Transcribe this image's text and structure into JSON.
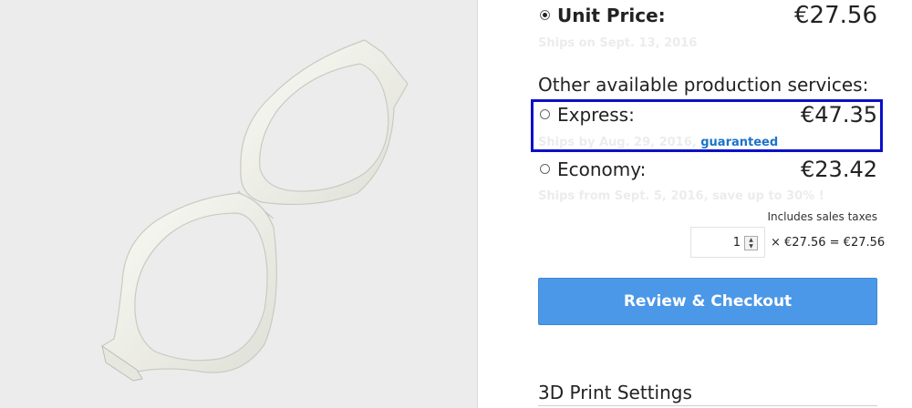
{
  "unit_price": {
    "label": "Unit Price:",
    "price": "€27.56",
    "ships": "Ships on Sept. 13, 2016",
    "selected": true
  },
  "other_services_heading": "Other available production services:",
  "services": [
    {
      "label": "Express:",
      "price": "€47.35",
      "ships": "Ships by Aug. 29, 2016,",
      "badge": "guaranteed",
      "selected": false
    },
    {
      "label": "Economy:",
      "price": "€23.42",
      "ships": "Ships from Sept. 5, 2016, save up to 30% !",
      "selected": false
    }
  ],
  "taxes_note": "Includes sales taxes",
  "quantity": {
    "value": "1",
    "calc": "× €27.56 = €27.56"
  },
  "checkout_label": "Review & Checkout",
  "settings_heading": "3D Print Settings",
  "colors": {
    "accent": "#4b97e8",
    "highlight_border": "#0b10c8",
    "link": "#1a73c9",
    "preview_bg": "#ececec"
  }
}
